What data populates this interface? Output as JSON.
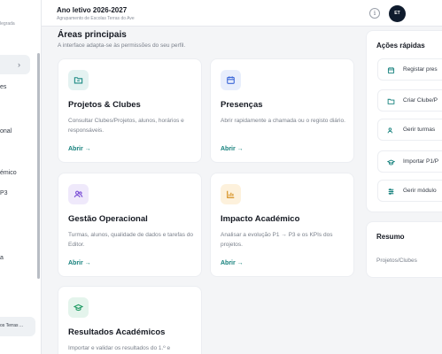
{
  "sidebar": {
    "subtitle": "legrada",
    "items": [
      {
        "label": "es"
      },
      {
        "label": "onal"
      },
      {
        "label": "émico"
      },
      {
        "label": "P3"
      },
      {
        "label": "a"
      }
    ],
    "footer": "os Terras ..."
  },
  "header": {
    "title": "Ano letivo 2026-2027",
    "subtitle": "Agrupamento de Escolas Terras do Ave",
    "info_icon": "info-icon",
    "avatar_initials": "ET"
  },
  "main": {
    "section_title": "Áreas principais",
    "section_subtitle": "A interface adapta-se às permissões do seu perfil.",
    "cards": [
      {
        "title": "Projetos & Clubes",
        "description": "Consultar Clubes/Projetos, alunos, horários e responsáveis.",
        "link": "Abrir →",
        "icon": "folder-icon",
        "icon_bg": "#e4f2f1",
        "icon_color": "#1d8a84"
      },
      {
        "title": "Presenças",
        "description": "Abrir rapidamente a chamada ou o registo diário.",
        "link": "Abrir →",
        "icon": "calendar-icon",
        "icon_bg": "#e8eefc",
        "icon_color": "#3d68d8"
      },
      {
        "title": "Gestão Operacional",
        "description": "Turmas, alunos, qualidade de dados e tarefas do Editor.",
        "link": "Abrir →",
        "icon": "users-icon",
        "icon_bg": "#efe9fb",
        "icon_color": "#7b4fd6"
      },
      {
        "title": "Impacto Académico",
        "description": "Analisar a evolução P1 → P3 e os KPIs dos projetos.",
        "link": "Abrir →",
        "icon": "bar-chart-icon",
        "icon_bg": "#fdf1dc",
        "icon_color": "#d48a14"
      },
      {
        "title": "Resultados Académicos",
        "description": "Importar e validar os resultados do 1.º e",
        "link": "",
        "icon": "graduation-cap-icon",
        "icon_bg": "#e4f4ec",
        "icon_color": "#1f9a63"
      }
    ]
  },
  "quick_actions": {
    "title": "Ações rápidas",
    "items": [
      {
        "label": "Registar pres",
        "icon": "calendar-icon"
      },
      {
        "label": "Criar Clube/P",
        "icon": "folder-icon"
      },
      {
        "label": "Gerir turmas",
        "icon": "users-icon"
      },
      {
        "label": "Importar P1/P",
        "icon": "graduation-cap-icon"
      },
      {
        "label": "Gerir módulo",
        "icon": "sliders-icon"
      }
    ]
  },
  "summary": {
    "title": "Resumo",
    "rows": [
      {
        "label": "Projetos/Clubes"
      }
    ]
  },
  "colors": {
    "accent": "#14807c",
    "avatar_bg": "#0f1b2d"
  }
}
